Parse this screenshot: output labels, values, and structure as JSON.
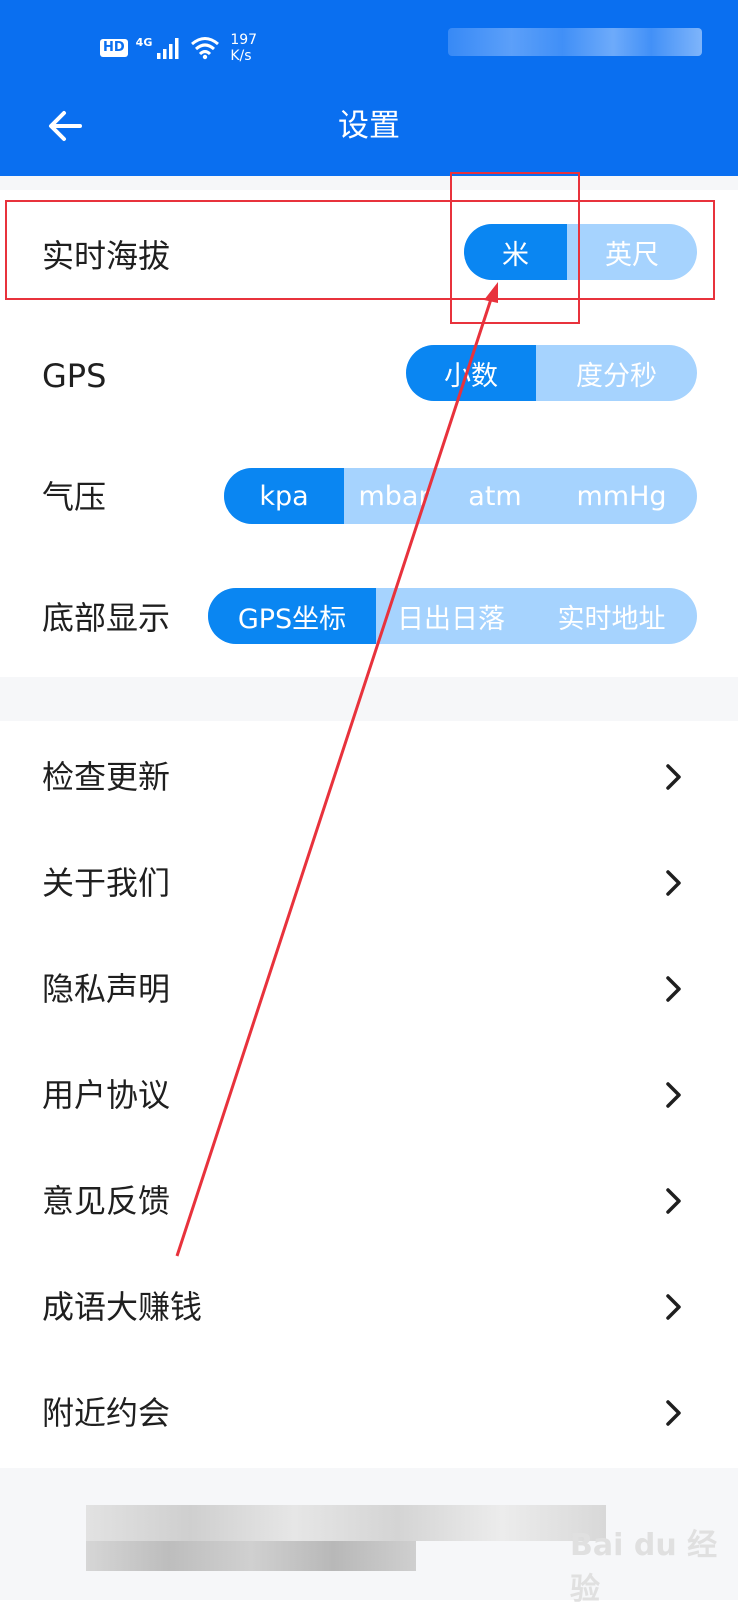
{
  "status_bar": {
    "hd": "HD",
    "network": "4G",
    "speed_value": "197",
    "speed_unit": "K/s"
  },
  "header": {
    "title": "设置"
  },
  "settings": {
    "altitude": {
      "label": "实时海拔",
      "options": [
        "米",
        "英尺"
      ],
      "selected": "米"
    },
    "gps": {
      "label": "GPS",
      "options": [
        "小数",
        "度分秒"
      ],
      "selected": "小数"
    },
    "pressure": {
      "label": "气压",
      "options": [
        "kpa",
        "mbar",
        "atm",
        "mmHg"
      ],
      "selected": "kpa"
    },
    "bottom_display": {
      "label": "底部显示",
      "options": [
        "GPS坐标",
        "日出日落",
        "实时地址"
      ],
      "selected": "GPS坐标"
    }
  },
  "menu": [
    {
      "label": "检查更新"
    },
    {
      "label": "关于我们"
    },
    {
      "label": "隐私声明"
    },
    {
      "label": "用户协议"
    },
    {
      "label": "意见反馈"
    },
    {
      "label": "成语大赚钱"
    },
    {
      "label": "附近约会"
    }
  ],
  "watermark": "Bai du 经验",
  "colors": {
    "primary": "#0a6ff0",
    "segment_active": "#0a86f2",
    "segment_inactive": "#a6d3fe",
    "annotation": "#e8323c"
  }
}
